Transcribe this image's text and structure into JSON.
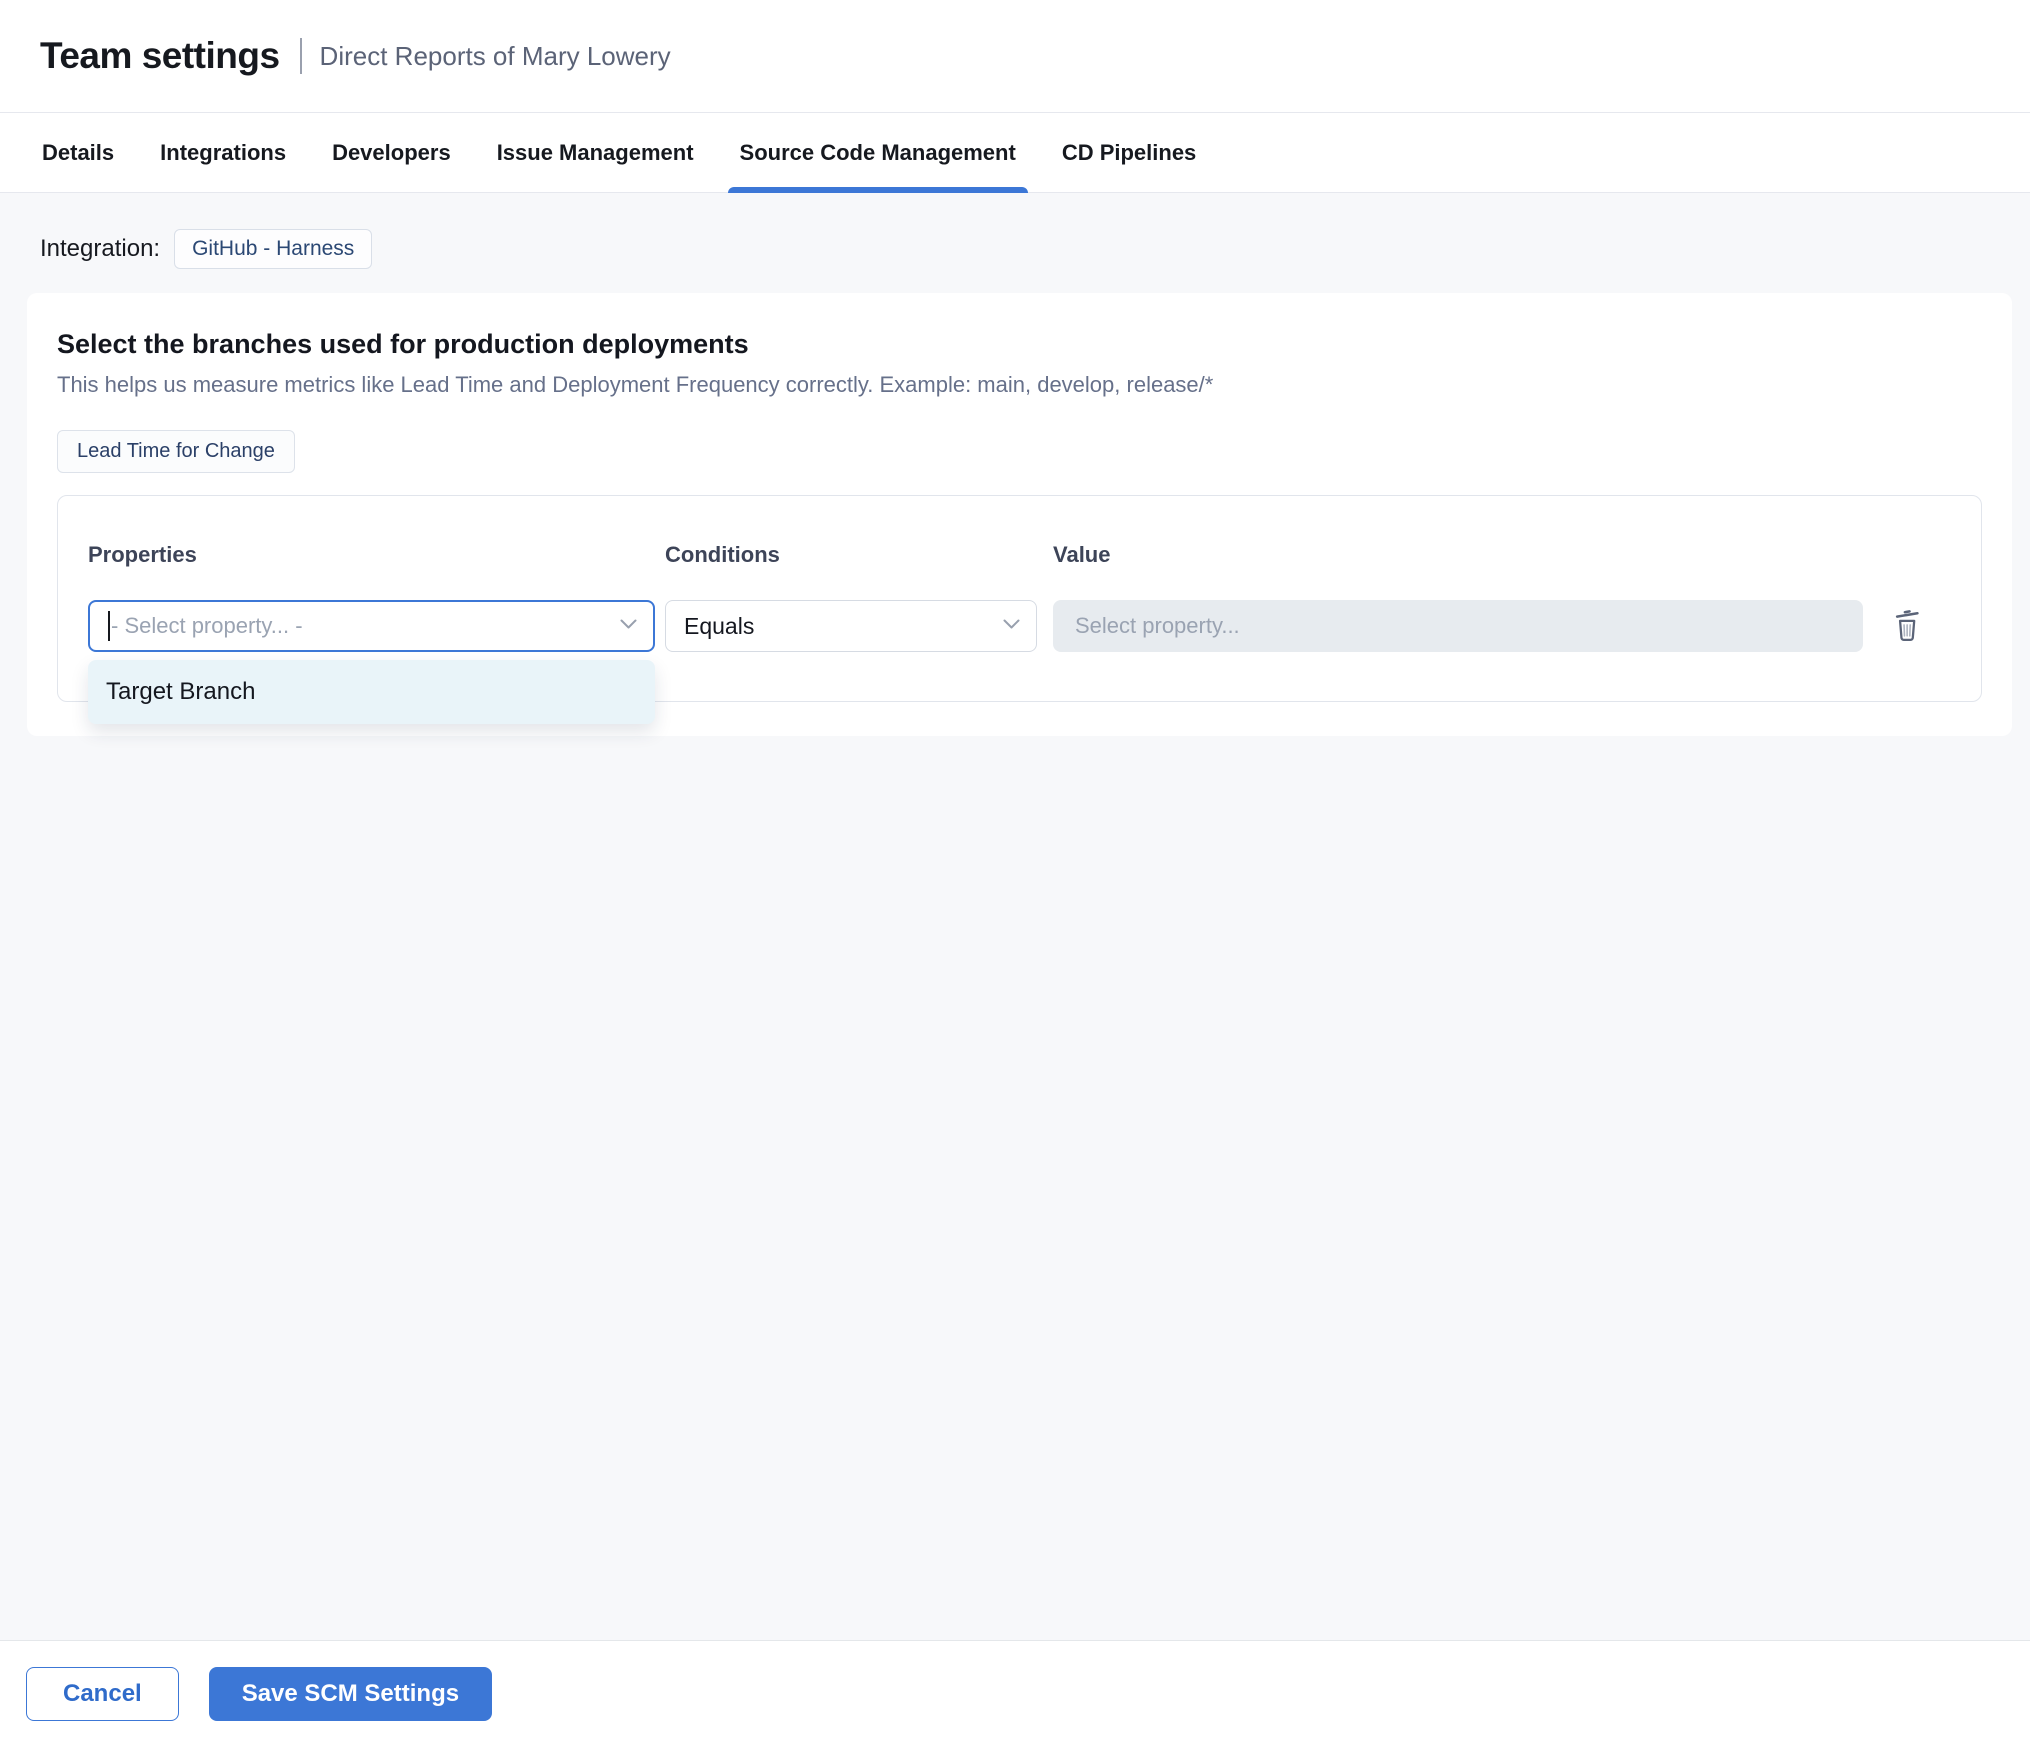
{
  "header": {
    "title": "Team settings",
    "subtitle": "Direct Reports of Mary Lowery"
  },
  "tabs": [
    {
      "label": "Details",
      "active": false
    },
    {
      "label": "Integrations",
      "active": false
    },
    {
      "label": "Developers",
      "active": false
    },
    {
      "label": "Issue Management",
      "active": false
    },
    {
      "label": "Source Code Management",
      "active": true
    },
    {
      "label": "CD Pipelines",
      "active": false
    }
  ],
  "integration": {
    "label": "Integration:",
    "value": "GitHub - Harness"
  },
  "card": {
    "heading": "Select the branches used for production deployments",
    "description": "This helps us measure metrics like Lead Time and Deployment Frequency correctly. Example: main, develop, release/*",
    "metric_tag": "Lead Time for Change",
    "rule": {
      "properties_label": "Properties",
      "conditions_label": "Conditions",
      "value_label": "Value",
      "property_placeholder": "- Select property... -",
      "condition_value": "Equals",
      "value_placeholder": "Select property...",
      "dropdown_options": [
        "Target Branch"
      ]
    }
  },
  "footer": {
    "cancel_label": "Cancel",
    "save_label": "Save SCM Settings"
  },
  "icons": {
    "chevron": "chevron-down-icon",
    "trash": "trash-icon",
    "cursor": "text-cursor"
  },
  "colors": {
    "accent": "#3c77d6",
    "chip_text": "#2b4874",
    "dropdown_highlight": "#e9f4f9",
    "disabled_input_bg": "#e7ebef",
    "page_bg": "#f7f8fa"
  }
}
